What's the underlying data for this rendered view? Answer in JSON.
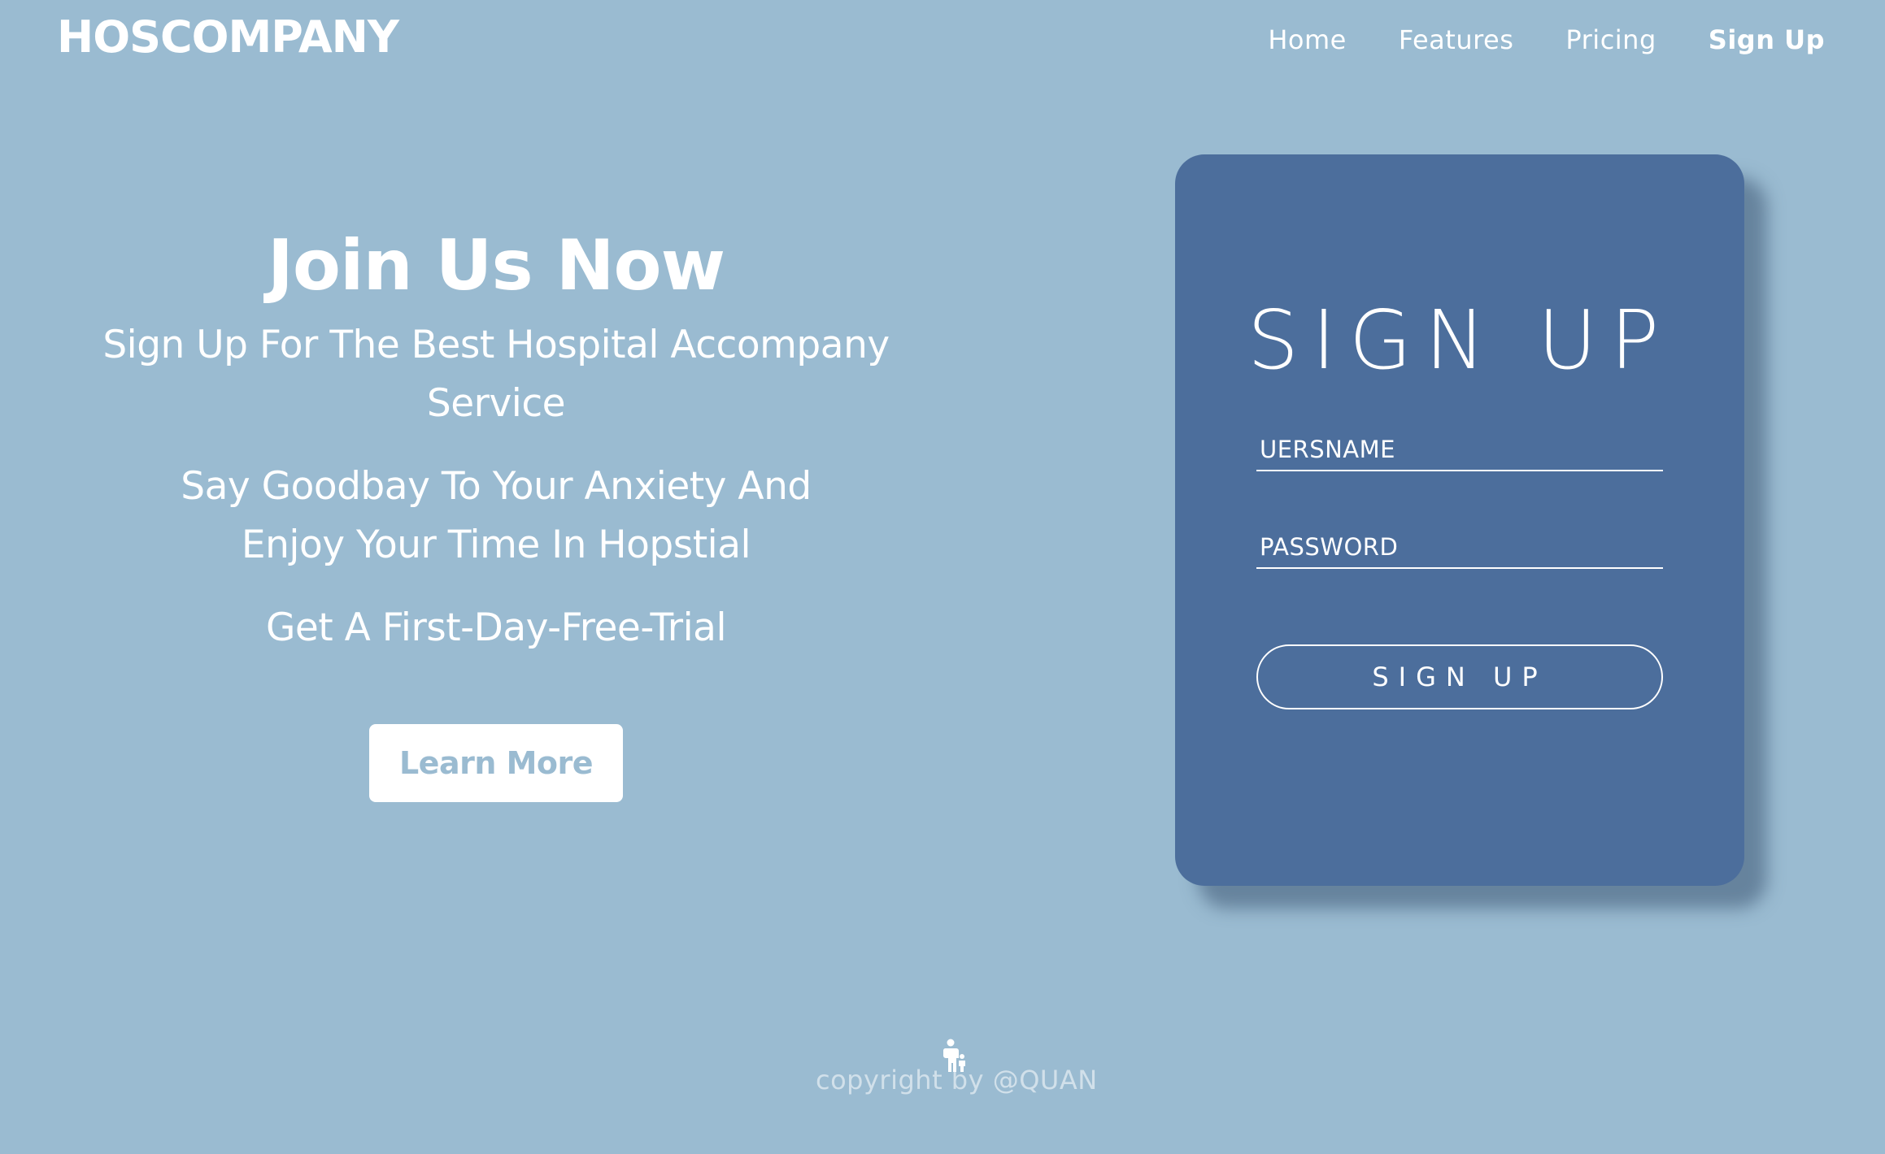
{
  "header": {
    "brand": "HOSCOMPANY",
    "nav": [
      {
        "label": "Home"
      },
      {
        "label": "Features"
      },
      {
        "label": "Pricing"
      },
      {
        "label": "Sign Up"
      }
    ]
  },
  "hero": {
    "title": "Join Us Now",
    "line1": "Sign Up For The Best Hospital Accompany Service",
    "line2": "Say Goodbay To Your Anxiety And Enjoy Your Time In Hopstial",
    "line3": "Get A First-Day-Free-Trial",
    "button_label": "Learn More"
  },
  "signup_card": {
    "title": "SIGN UP",
    "username_placeholder": "UERSNAME",
    "password_placeholder": "PASSWORD",
    "submit_label": "SIGN UP"
  },
  "footer": {
    "copyright": "copyright by @QUAN",
    "icon": "person-with-child-icon"
  },
  "colors": {
    "background": "#9abbd1",
    "card": "#4c6e9c",
    "text": "#ffffff"
  }
}
